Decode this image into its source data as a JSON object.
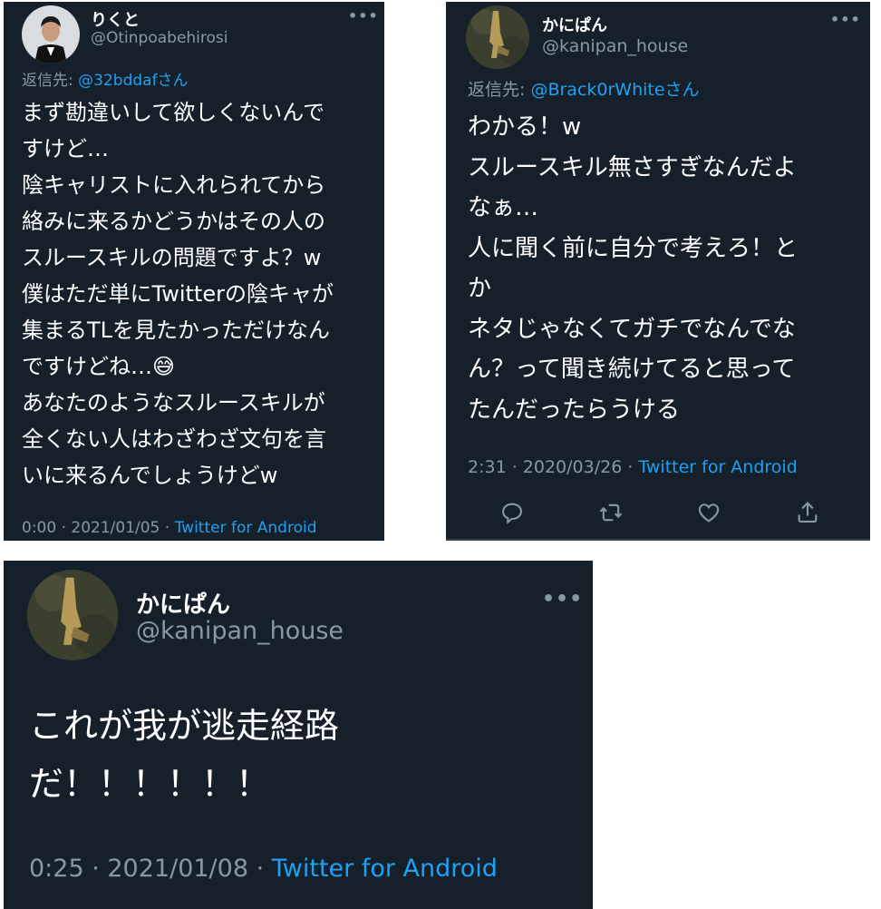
{
  "tweets": [
    {
      "display_name": "りくと",
      "handle": "@Otinpoabehirosi",
      "more_label": "•••",
      "reply_prefix": "返信先: ",
      "reply_mention": "@32bddafさん",
      "text": "まず勘違いして欲しくないんで\nすけど…\n陰キャリストに入れられてから\n絡みに来るかどうかはその人の\nスルースキルの問題ですよ？w\n僕はただ単にTwitterの陰キャが\n集まるTLを見たかっただけなん\nですけどね…😅\nあなたのようなスルースキルが\n全くない人はわざわざ文句を言\nいに来るんでしょうけどw",
      "timestamp": "0:00 · 2021/01/05 · ",
      "source": "Twitter for Android"
    },
    {
      "display_name": "かにぱん",
      "handle": "@kanipan_house",
      "more_label": "•••",
      "reply_prefix": "返信先: ",
      "reply_mention": "@Brack0rWhiteさん",
      "text": "わかる！w\nスルースキル無さすぎなんだよ\nなぁ…\n人に聞く前に自分で考えろ！と\nか\nネタじゃなくてガチでなんでな\nん？って聞き続けてると思って\nたんだったらうける",
      "timestamp": "2:31 · 2020/03/26 · ",
      "source": "Twitter for Android",
      "actions": [
        "reply-icon",
        "retweet-icon",
        "like-icon",
        "share-icon"
      ]
    },
    {
      "display_name": "かにぱん",
      "handle": "@kanipan_house",
      "more_label": "•••",
      "text": "これが我が逃走経路\nだ！！！！！！",
      "timestamp": "0:25 · 2021/01/08 · ",
      "source": "Twitter for Android"
    }
  ],
  "colors": {
    "background": "#15202b",
    "text": "#ffffff",
    "secondary": "#8899a6",
    "link": "#1da1f2"
  }
}
